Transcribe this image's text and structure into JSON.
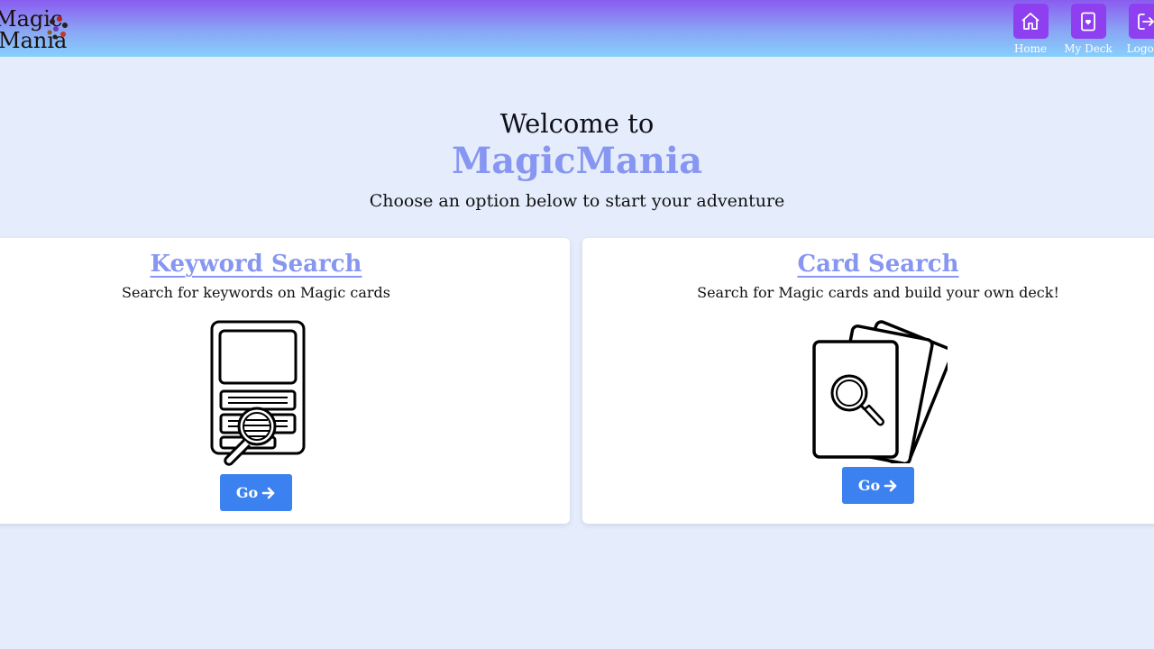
{
  "navbar": {
    "logo": {
      "line1": "Magic",
      "line2": "Mania"
    },
    "items": [
      {
        "label": "Home",
        "icon": "home-icon"
      },
      {
        "label": "My Deck",
        "icon": "deck-icon"
      },
      {
        "label": "Logout",
        "icon": "logout-icon"
      }
    ]
  },
  "hero": {
    "welcome": "Welcome to",
    "brand": "MagicMania",
    "subtitle": "Choose an option below to start your adventure"
  },
  "options": [
    {
      "title": "Keyword Search",
      "description": "Search for keywords on Magic cards",
      "illustration": "keyword-card-magnifier-icon",
      "button_label": "Go"
    },
    {
      "title": "Card Search",
      "description": "Search for Magic cards and build your own deck!",
      "illustration": "card-stack-magnifier-icon",
      "button_label": "Go"
    }
  ],
  "colors": {
    "background": "#e5edfc",
    "accent_purple": "#8e3ff0",
    "brand_text": "#8796f0",
    "button_blue": "#3b82f0"
  }
}
